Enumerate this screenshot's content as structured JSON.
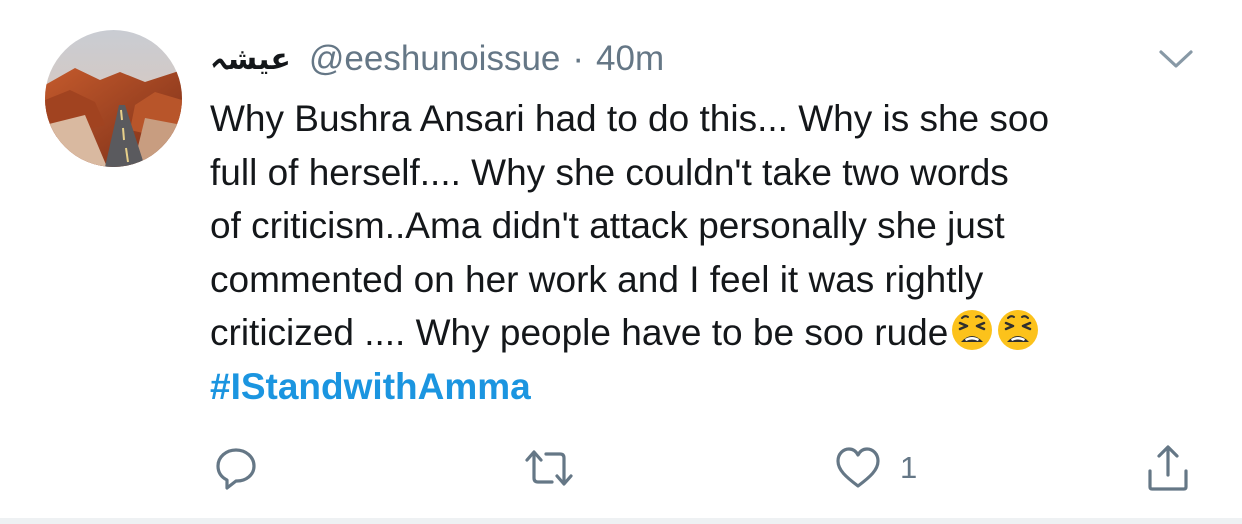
{
  "tweet": {
    "display_name": "عیشہ",
    "handle": "@eeshunoissue",
    "separator": "·",
    "time": "40m",
    "text_lines": [
      "Why Bushra Ansari had to do this... Why is she soo",
      "full of herself.... Why she couldn't take two words",
      "of criticism..Ama didn't attack personally she just",
      "commented on her work and I feel it was rightly",
      "criticized .... Why people have to be soo rude"
    ],
    "trailing_emojis": [
      "weary-face-emoji",
      "weary-face-emoji"
    ],
    "hashtag": "#IStandwithAmma",
    "like_count": "1"
  },
  "icons": {
    "caret": "chevron-down-icon",
    "reply": "reply-icon",
    "retweet": "retweet-icon",
    "like": "heart-icon",
    "share": "share-icon"
  },
  "colors": {
    "text": "#14171a",
    "secondary": "#657786",
    "link": "#1b95e0",
    "divider": "#eef1f3",
    "emoji": "#fcc21b"
  }
}
